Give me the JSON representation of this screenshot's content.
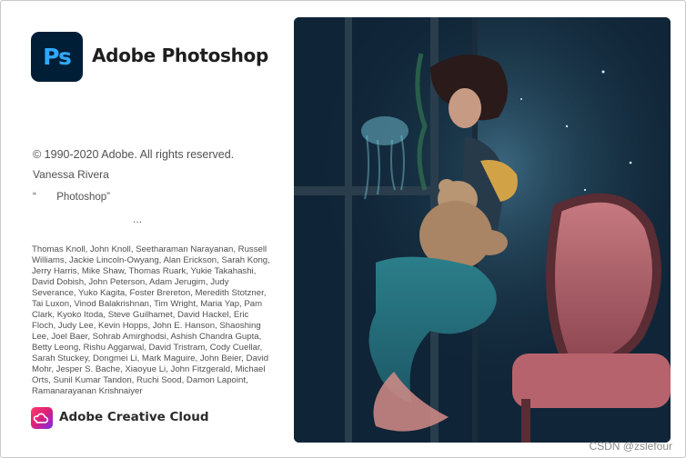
{
  "app": {
    "logo_text": "Ps",
    "title": "Adobe Photoshop",
    "brand_colors": {
      "logo_bg": "#001e36",
      "logo_fg": "#31a8ff"
    }
  },
  "info": {
    "copyright": "© 1990-2020 Adobe. All rights reserved.",
    "licensee": "Vanessa Rivera",
    "edition": "“       Photoshop”",
    "loading": "..."
  },
  "credits": "Thomas Knoll, John Knoll, Seetharaman Narayanan, Russell Williams, Jackie Lincoln-Owyang, Alan Erickson, Sarah Kong, Jerry Harris, Mike Shaw, Thomas Ruark, Yukie Takahashi, David Dobish, John Peterson, Adam Jerugim, Judy Severance, Yuko Kagita, Foster Brereton, Meredith Stotzner, Tai Luxon, Vinod Balakrishnan, Tim Wright, Maria Yap, Pam Clark, Kyoko Itoda, Steve Guilhamet, David Hackel, Eric Floch, Judy Lee, Kevin Hopps, John E. Hanson, Shaoshing Lee, Joel Baer, Sohrab Amirghodsi, Ashish Chandra Gupta, Betty Leong, Rishu Aggarwal, David Tristram, Cody Cuellar, Sarah Stuckey, Dongmei Li, Mark Maguire, John Beier, David Mohr, Jesper S. Bache, Xiaoyue Li, John Fitzgerald, Michael Orts, Sunil Kumar Tandon, Ruchi Sood, Damon Lapoint, Ramanarayanan Krishnaiyer",
  "footer": {
    "cc_icon": "creative-cloud-icon",
    "cc_label": "Adobe Creative Cloud"
  },
  "watermark": "CSDN @zslefour"
}
